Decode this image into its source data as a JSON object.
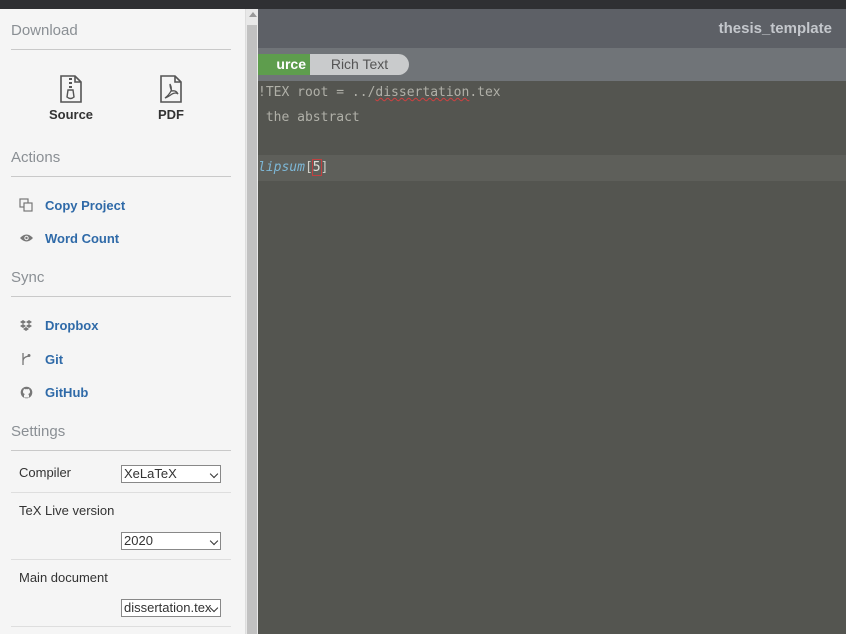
{
  "header": {
    "project_title": "thesis_template"
  },
  "editor_toggle": {
    "source": "urce",
    "rich_text": "Rich Text"
  },
  "code": {
    "line1": "!TEX root = ../",
    "line1_squiggle": "dissertation",
    "line1_rest": ".tex",
    "line2": " the abstract",
    "line4_cmd": "lipsum",
    "line4_open": "[",
    "line4_arg": "5",
    "line4_close": "]"
  },
  "panel": {
    "download": {
      "title": "Download",
      "items": [
        {
          "label": "Source",
          "icon": "zip-file-icon"
        },
        {
          "label": "PDF",
          "icon": "pdf-file-icon"
        }
      ]
    },
    "actions": {
      "title": "Actions",
      "items": [
        {
          "label": "Copy Project",
          "icon": "copy-icon"
        },
        {
          "label": "Word Count",
          "icon": "eye-icon"
        }
      ]
    },
    "sync": {
      "title": "Sync",
      "items": [
        {
          "label": "Dropbox",
          "icon": "dropbox-icon"
        },
        {
          "label": "Git",
          "icon": "git-icon"
        },
        {
          "label": "GitHub",
          "icon": "github-icon"
        }
      ]
    },
    "settings": {
      "title": "Settings",
      "compiler_label": "Compiler",
      "compiler_value": "XeLaTeX",
      "texlive_label": "TeX Live version",
      "texlive_value": "2020",
      "main_doc_label": "Main document",
      "main_doc_value": "dissertation.tex"
    }
  },
  "colors": {
    "accent_green": "#5e9d4d",
    "link_blue": "#2f6aa8",
    "editor_bg": "#545550"
  }
}
